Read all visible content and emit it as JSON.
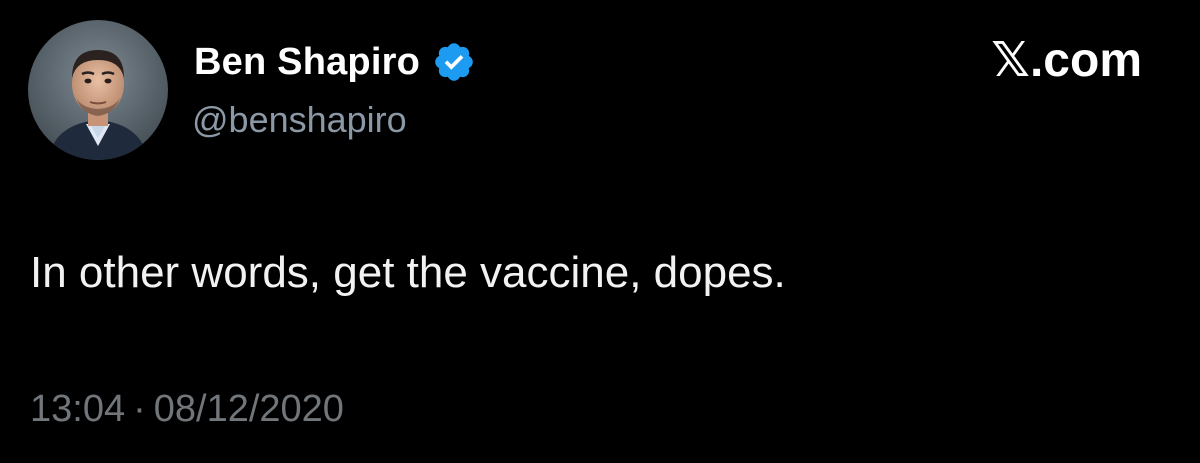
{
  "author": {
    "display_name": "Ben Shapiro",
    "handle": "@benshapiro",
    "verified": true,
    "avatar_icon": "profile-photo-avatar"
  },
  "brand": {
    "label": "𝕏.com"
  },
  "tweet": {
    "text": "In other words, get the vaccine, dopes.",
    "time": "13:04",
    "separator": "·",
    "date": "08/12/2020"
  },
  "colors": {
    "background": "#000000",
    "name": "#ffffff",
    "handle": "#8b98a5",
    "body": "#f2f2f2",
    "meta": "#71767b",
    "verified": "#1d9bf0"
  }
}
